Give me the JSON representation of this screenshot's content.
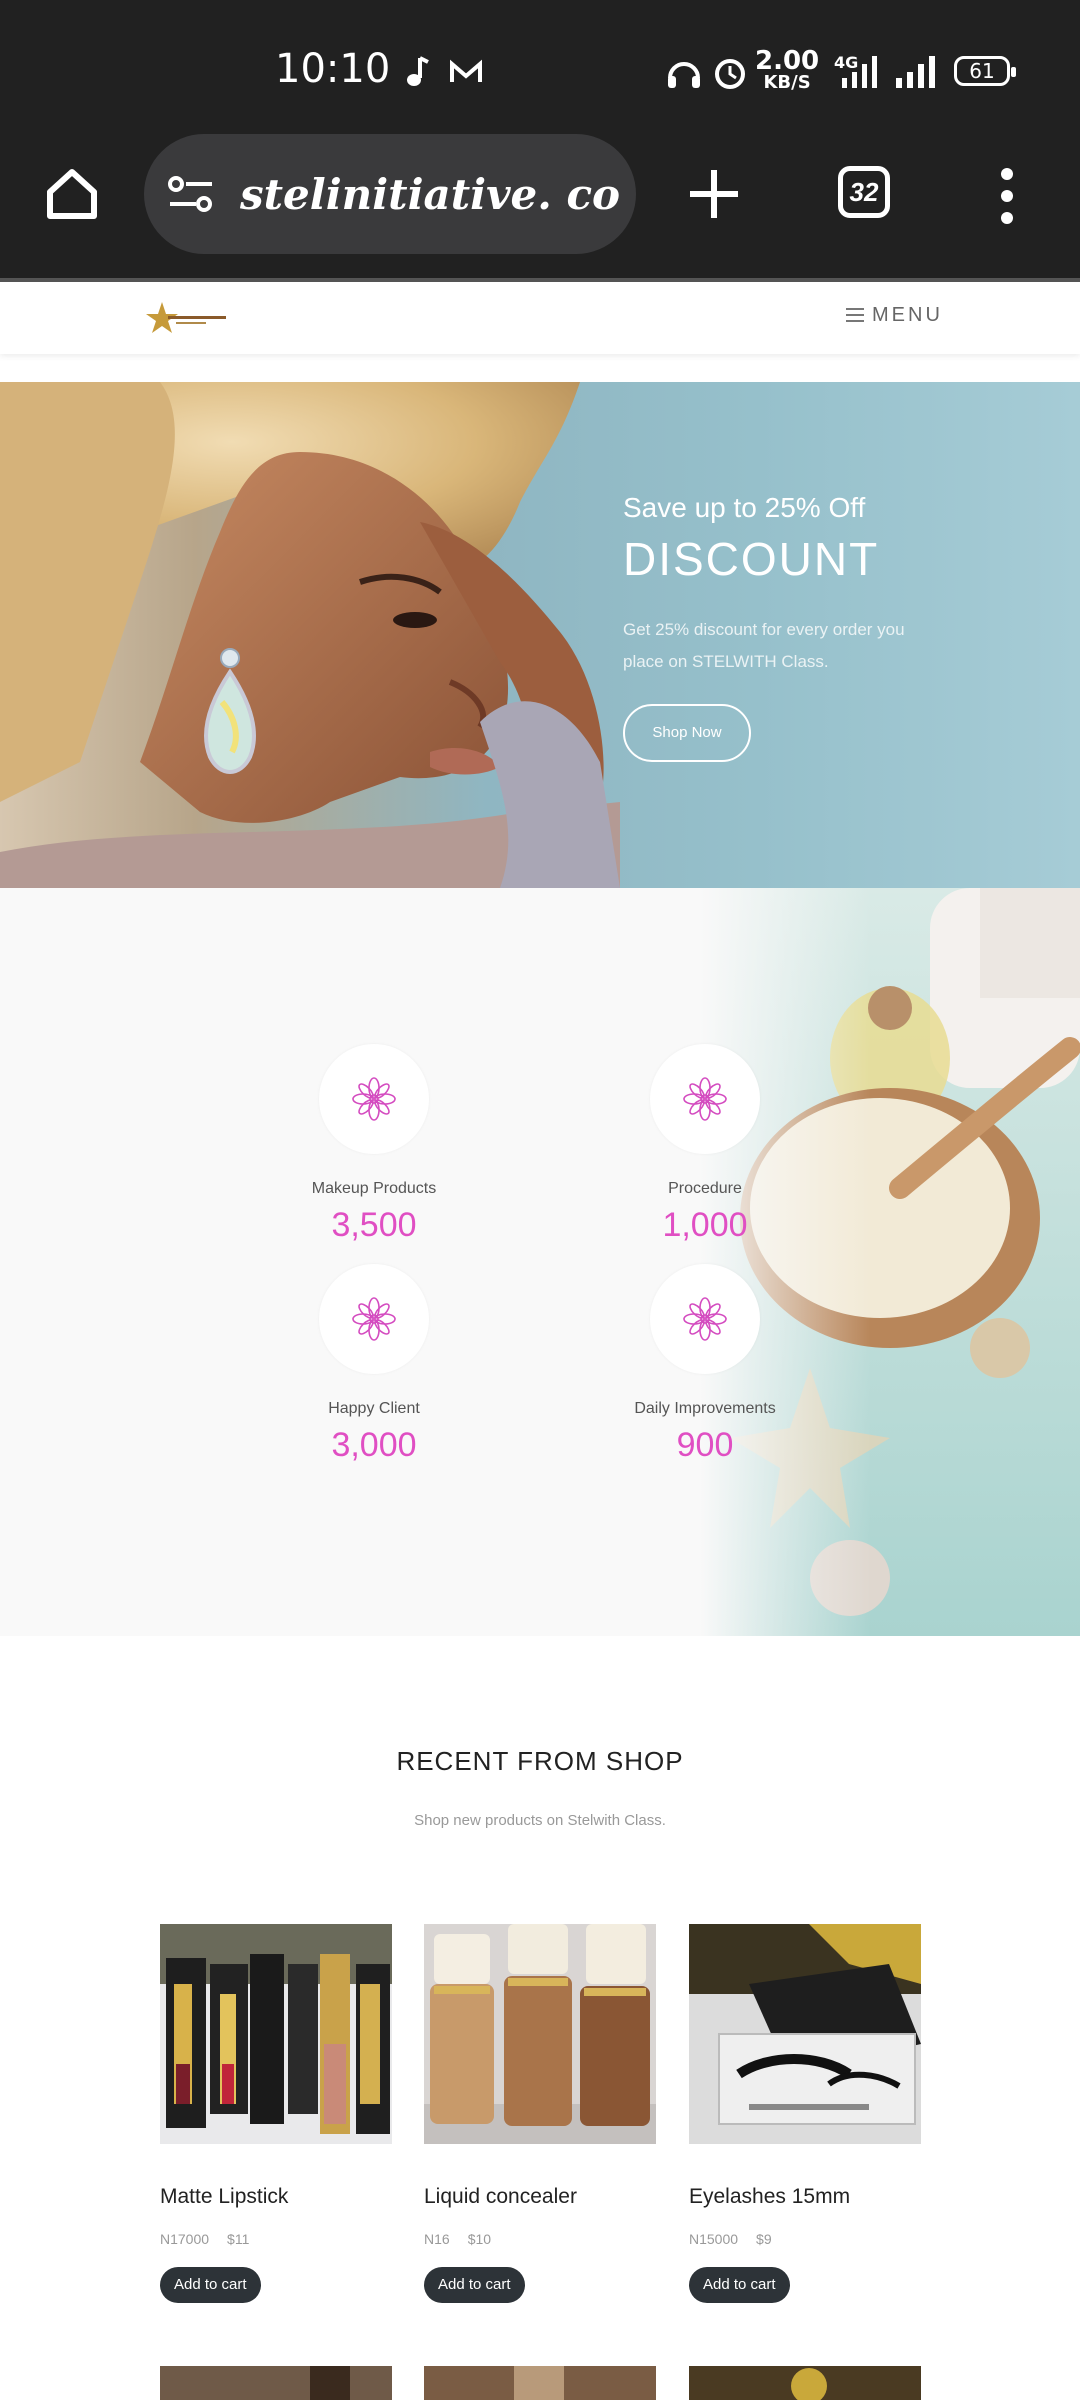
{
  "status_bar": {
    "time": "10:10",
    "net_speed": "2.00",
    "net_speed_unit": "KB/S",
    "network": "4G",
    "battery": "61"
  },
  "browser": {
    "url": "stelinitiative. com/m",
    "tab_count": "32"
  },
  "site_header": {
    "menu_label": "MENU"
  },
  "hero": {
    "subtitle": "Save up to 25% Off",
    "title": "DISCOUNT",
    "description": "Get 25% discount for every order you place on STELWITH Class.",
    "button": "Shop Now"
  },
  "stats": [
    {
      "label": "Makeup Products",
      "value": "3,500"
    },
    {
      "label": "Procedure",
      "value": "1,000"
    },
    {
      "label": "Happy Client",
      "value": "3,000"
    },
    {
      "label": "Daily Improvements",
      "value": "900"
    }
  ],
  "recent": {
    "title": "RECENT FROM SHOP",
    "subtitle": "Shop new products on Stelwith Class."
  },
  "products": [
    {
      "name": "Matte Lipstick",
      "price_ngn": "N17000",
      "price_usd": "$11",
      "button": "Add to cart"
    },
    {
      "name": "Liquid concealer",
      "price_ngn": "N16",
      "price_usd": "$10",
      "button": "Add to cart"
    },
    {
      "name": "Eyelashes 15mm",
      "price_ngn": "N15000",
      "price_usd": "$9",
      "button": "Add to cart"
    }
  ],
  "colors": {
    "status_bar": "#212121",
    "accent_pink": "#e04fc3",
    "cart_button": "#2d3338"
  }
}
